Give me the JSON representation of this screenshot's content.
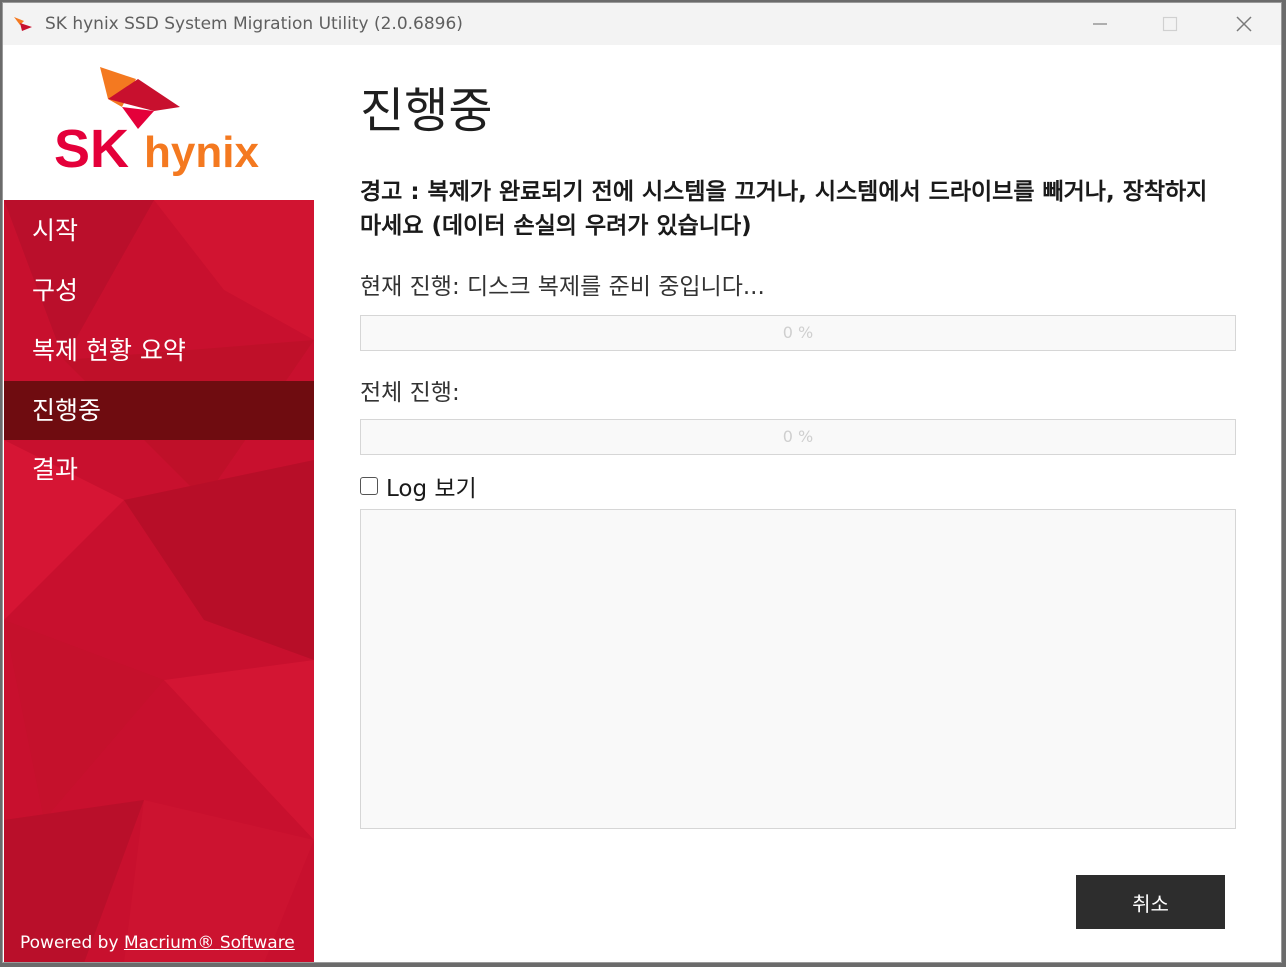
{
  "window": {
    "title": "SK hynix SSD System Migration Utility (2.0.6896)"
  },
  "branding": {
    "logo_sk": "SK",
    "logo_hynix": "hynix",
    "powered_prefix": "Powered by",
    "powered_link": "Macrium",
    "powered_mark": "®",
    "powered_suffix": "Software"
  },
  "sidebar": {
    "items": [
      {
        "label": "시작"
      },
      {
        "label": "구성"
      },
      {
        "label": "복제 현황 요약"
      },
      {
        "label": "진행중"
      },
      {
        "label": "결과"
      }
    ],
    "active_index": 3
  },
  "main": {
    "title": "진행중",
    "warning": "경고 : 복제가 완료되기 전에 시스템을 끄거나, 시스템에서 드라이브를 빼거나, 장착하지 마세요 (데이터 손실의 우려가 있습니다)",
    "current_label": "현재 진행: 디스크 복제를 준비 중입니다...",
    "current_progress": 0,
    "current_progress_text": "0 %",
    "total_label": "전체 진행:",
    "total_progress": 0,
    "total_progress_text": "0 %",
    "log_label": "Log 보기",
    "log_checked": false,
    "cancel_label": "취소"
  },
  "colors": {
    "brand_red": "#c8102e",
    "active_nav": "#6f0c10",
    "logo_orange": "#f47920",
    "button_dark": "#2d2d2d"
  }
}
